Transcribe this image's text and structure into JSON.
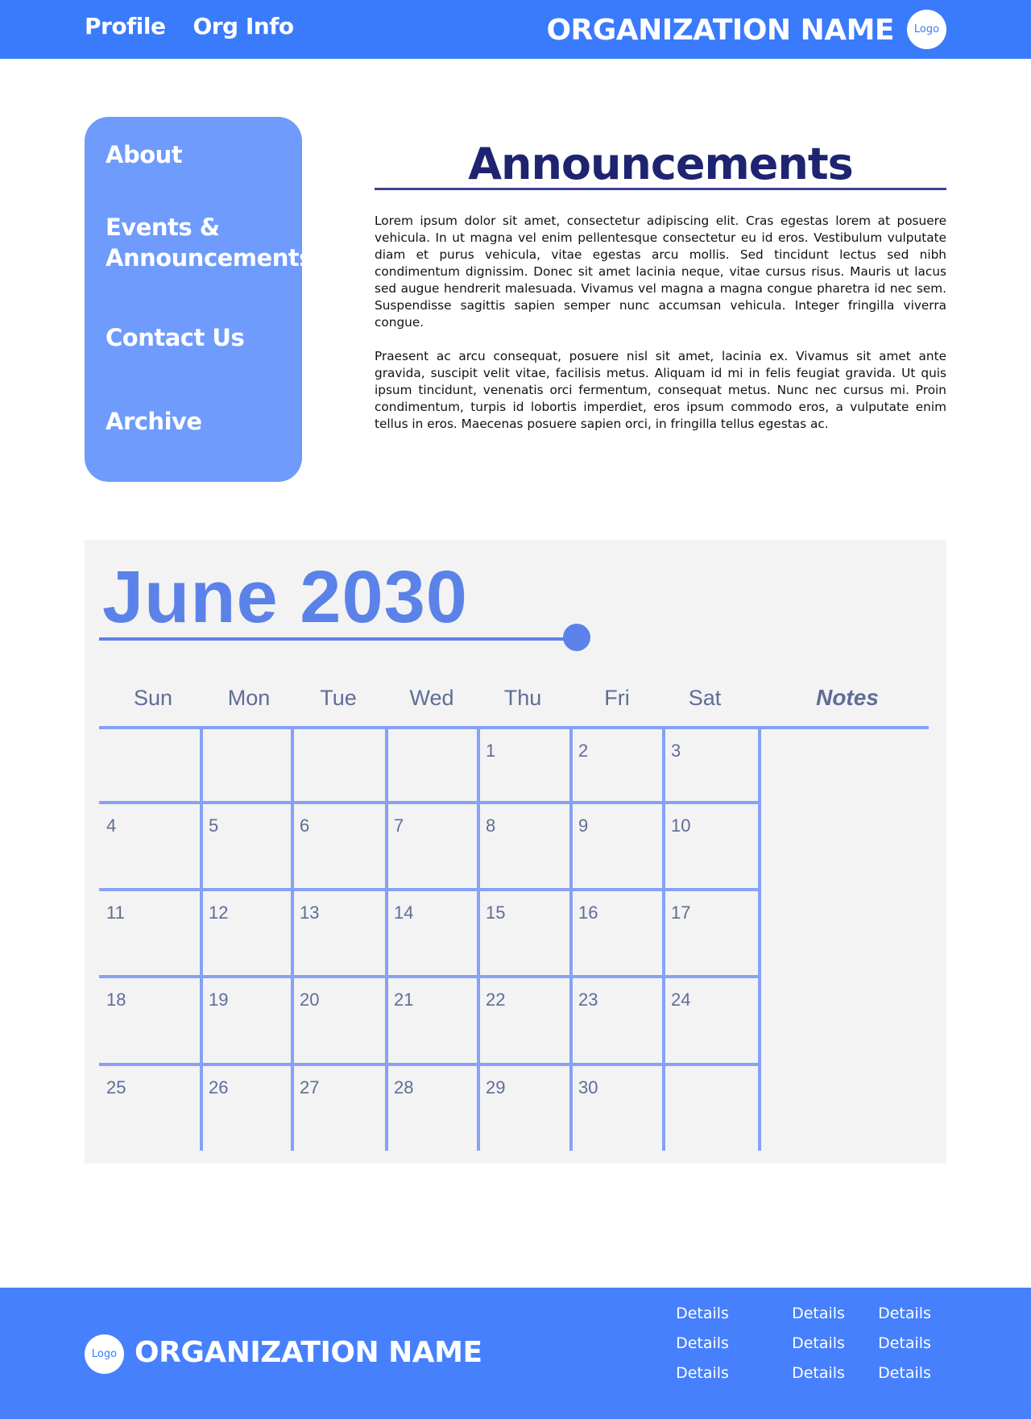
{
  "header": {
    "nav": [
      {
        "label": "Profile"
      },
      {
        "label": "Org Info"
      }
    ],
    "org_name": "ORGANIZATION NAME",
    "logo_text": "Logo"
  },
  "sidebar": {
    "items": [
      {
        "label": "About"
      },
      {
        "label": "Events & Announcements"
      },
      {
        "label": "Contact Us"
      },
      {
        "label": "Archive"
      }
    ]
  },
  "announcements": {
    "title": "Announcements",
    "paragraphs": [
      "Lorem ipsum dolor sit amet, consectetur adipiscing elit. Cras egestas lorem at posuere vehicula. In ut magna vel enim pellentesque consectetur eu id eros. Vestibulum vulputate diam et purus vehicula, vitae egestas arcu mollis. Sed tincidunt lectus sed nibh condimentum dignissim. Donec sit amet lacinia neque, vitae cursus risus. Mauris ut lacus sed augue hendrerit malesuada. Vivamus vel magna a magna congue pharetra id nec sem. Suspendisse sagittis sapien semper nunc accumsan vehicula. Integer fringilla viverra congue.",
      "Praesent ac arcu consequat, posuere nisl sit amet, lacinia ex. Vivamus sit amet ante gravida, suscipit velit vitae, facilisis metus. Aliquam id mi in felis feugiat gravida. Ut quis ipsum tincidunt, venenatis orci fermentum, consequat metus. Nunc nec cursus mi. Proin condimentum, turpis id lobortis imperdiet, eros ipsum commodo eros, a vulputate enim tellus in eros. Maecenas posuere sapien orci, in fringilla tellus egestas ac."
    ]
  },
  "calendar": {
    "month_title": "June 2030",
    "weekdays": [
      "Sun",
      "Mon",
      "Tue",
      "Wed",
      "Thu",
      "Fri",
      "Sat"
    ],
    "notes_label": "Notes",
    "weeks": [
      [
        "",
        "",
        "",
        "",
        "1",
        "2",
        "3"
      ],
      [
        "4",
        "5",
        "6",
        "7",
        "8",
        "9",
        "10"
      ],
      [
        "11",
        "12",
        "13",
        "14",
        "15",
        "16",
        "17"
      ],
      [
        "18",
        "19",
        "20",
        "21",
        "22",
        "23",
        "24"
      ],
      [
        "25",
        "26",
        "27",
        "28",
        "29",
        "30",
        ""
      ]
    ],
    "colors": {
      "title": "#5b82e8",
      "grid": "#86a1f6",
      "text": "#5f6d97",
      "panel": "#f3f3f3"
    }
  },
  "footer": {
    "logo_text": "Logo",
    "org_name": "ORGANIZATION NAME",
    "details": [
      "Details",
      "Details",
      "Details",
      "Details",
      "Details",
      "Details",
      "Details",
      "Details",
      "Details"
    ]
  },
  "colors": {
    "header_bg": "#3a7bfc",
    "sidebar_bg": "#6e9bfc",
    "footer_bg": "#4680fc",
    "heading": "#1e2470"
  }
}
